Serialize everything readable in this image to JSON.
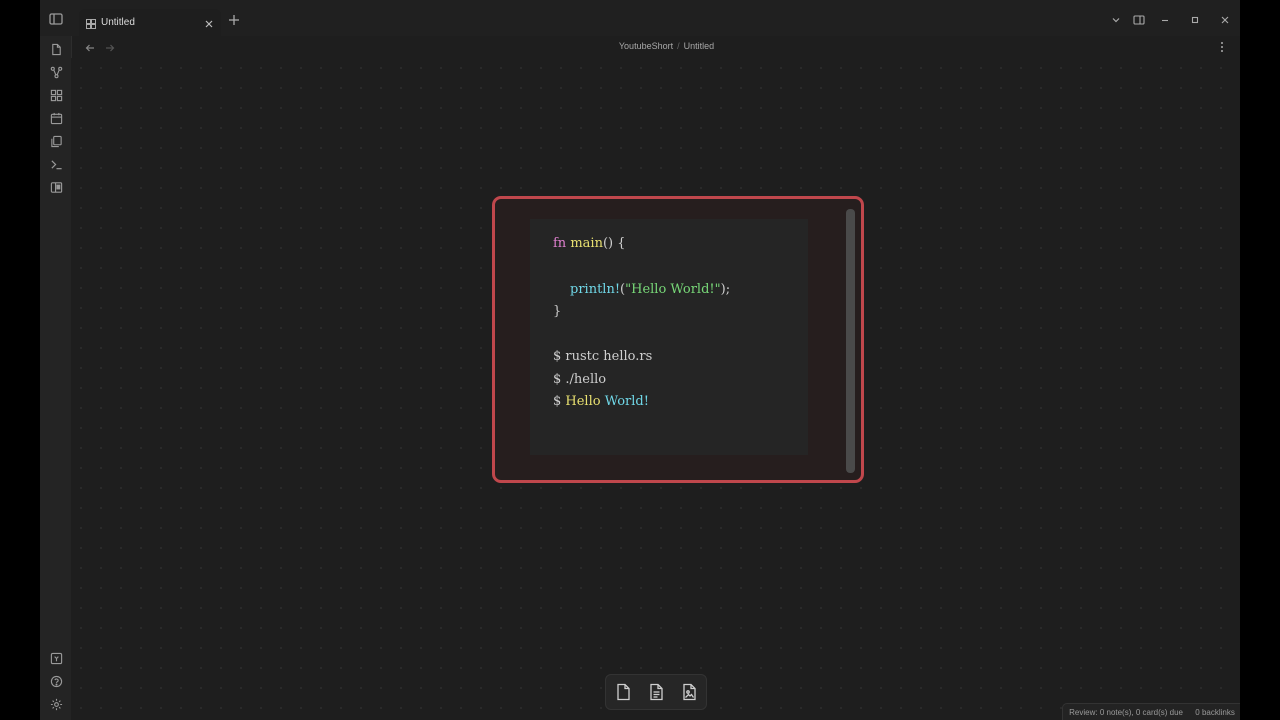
{
  "tabs": [
    {
      "title": "Untitled"
    }
  ],
  "breadcrumb": {
    "vault": "YoutubeShort",
    "separator": "/",
    "file": "Untitled"
  },
  "ribbon": {
    "top": [
      "open-quick-switcher-icon",
      "graph-view-icon",
      "canvas-icon",
      "daily-note-icon",
      "templates-icon",
      "command-palette-icon",
      "publish-icon"
    ],
    "bottom": [
      "vault-switcher-icon",
      "help-icon",
      "settings-icon"
    ]
  },
  "canvas_controls": [
    "settings-icon",
    "zoom-in-icon",
    "reset-zoom-icon",
    "zoom-to-fit-icon",
    "zoom-out-icon",
    "undo-icon",
    "redo-icon",
    "help-icon"
  ],
  "code": {
    "fn_line": {
      "kw": "fn",
      "name": "main",
      "rest": "() {"
    },
    "println_line": {
      "macro": "println!",
      "open": "(",
      "string": "\"Hello World!\"",
      "close": ");"
    },
    "close_brace": "}",
    "cmd1": "$ rustc hello.rs",
    "cmd2": "$ ./hello",
    "out_prompt": "$ ",
    "out_word1": "Hello",
    "out_word2": "World!"
  },
  "status": {
    "review": "Review: 0 note(s), 0 card(s) due",
    "backlinks": "0 backlinks"
  },
  "colors": {
    "card_border": "#c0474c",
    "keyword": "#e080d0",
    "function": "#e8e070",
    "macro": "#70d8e8",
    "string": "#78d878"
  }
}
